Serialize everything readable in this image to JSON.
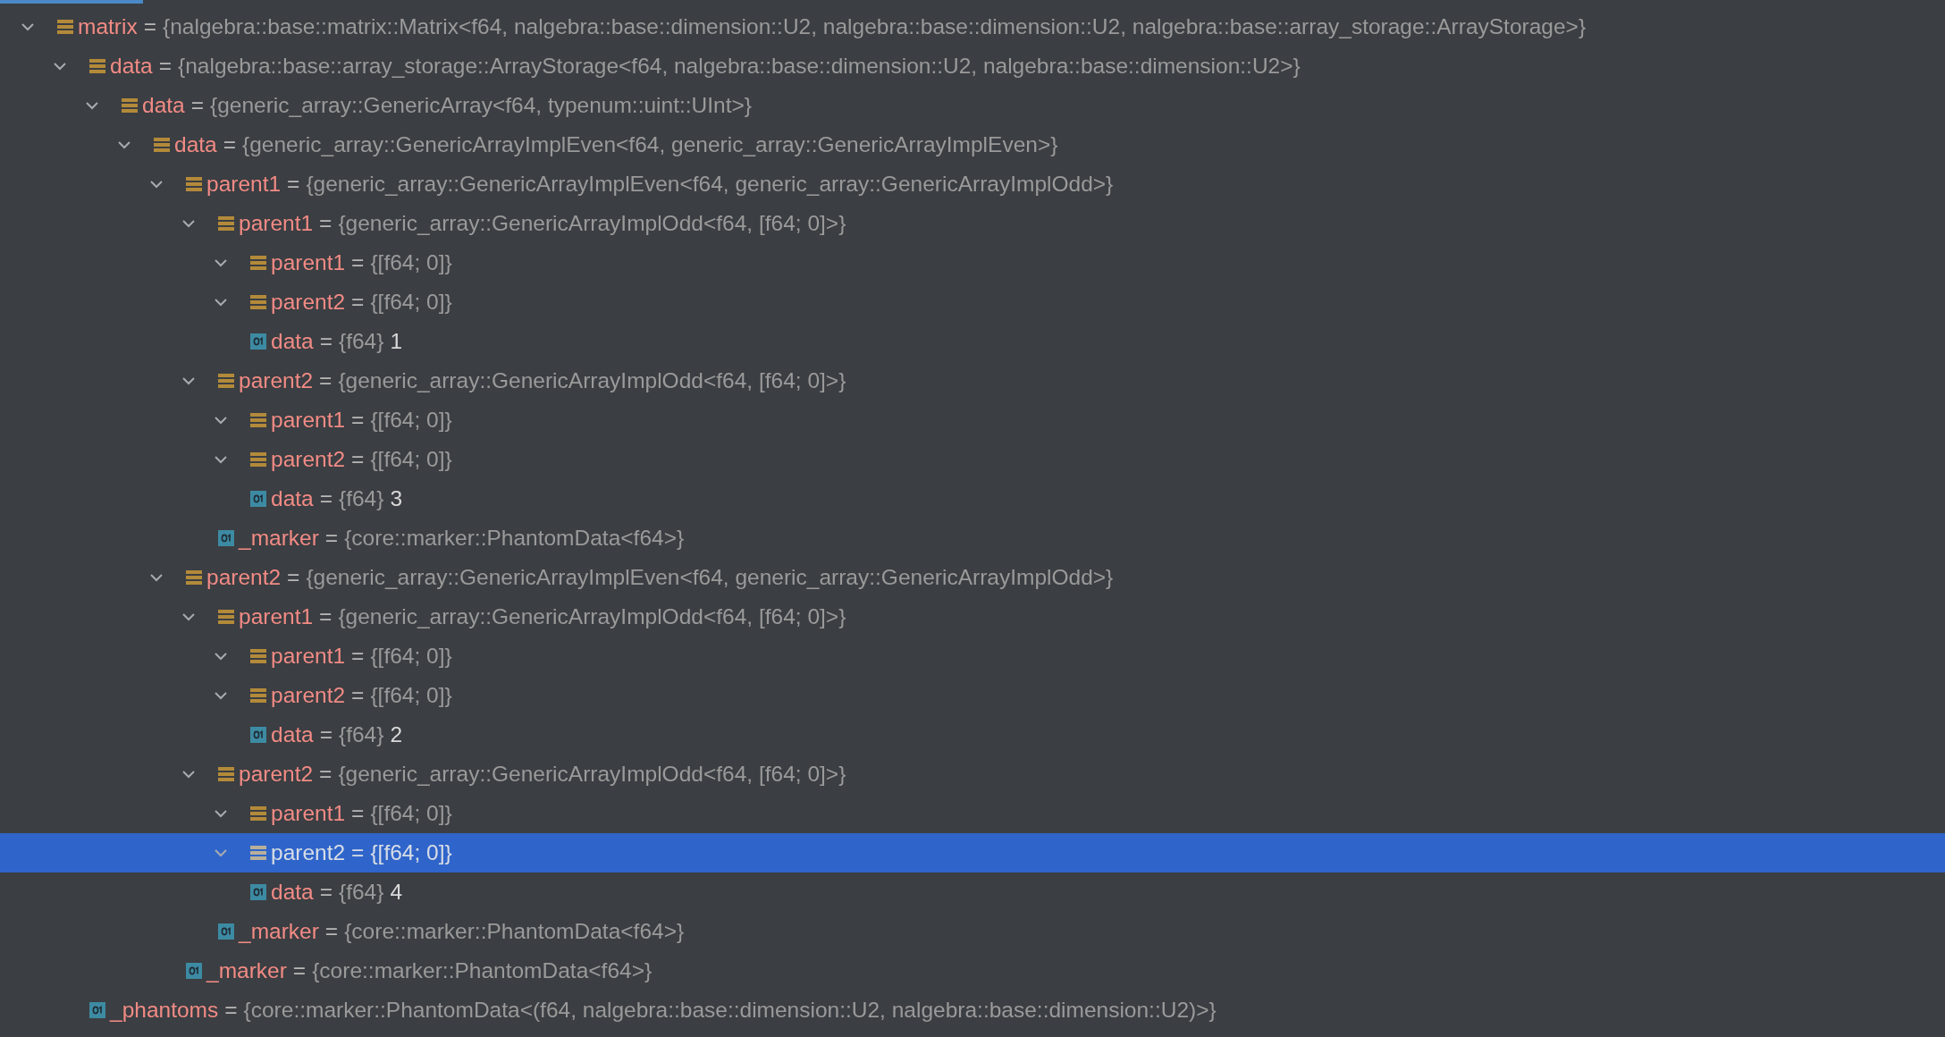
{
  "variables": [
    {
      "name": "matrix",
      "op": "=",
      "type": "{nalgebra::base::matrix::Matrix<f64, nalgebra::base::dimension::U2, nalgebra::base::dimension::U2, nalgebra::base::array_storage::ArrayStorage>}",
      "kind": "struct",
      "expanded": true,
      "selected": false,
      "children": [
        {
          "name": "data",
          "op": "=",
          "type": "{nalgebra::base::array_storage::ArrayStorage<f64, nalgebra::base::dimension::U2, nalgebra::base::dimension::U2>}",
          "kind": "struct",
          "expanded": true,
          "selected": false,
          "children": [
            {
              "name": "data",
              "op": "=",
              "type": "{generic_array::GenericArray<f64, typenum::uint::UInt>}",
              "kind": "struct",
              "expanded": true,
              "selected": false,
              "children": [
                {
                  "name": "data",
                  "op": "=",
                  "type": "{generic_array::GenericArrayImplEven<f64, generic_array::GenericArrayImplEven>}",
                  "kind": "struct",
                  "expanded": true,
                  "selected": false,
                  "children": [
                    {
                      "name": "parent1",
                      "op": "=",
                      "type": "{generic_array::GenericArrayImplEven<f64, generic_array::GenericArrayImplOdd>}",
                      "kind": "struct",
                      "expanded": true,
                      "selected": false,
                      "children": [
                        {
                          "name": "parent1",
                          "op": "=",
                          "type": "{generic_array::GenericArrayImplOdd<f64, [f64; 0]>}",
                          "kind": "struct",
                          "expanded": true,
                          "selected": false,
                          "children": [
                            {
                              "name": "parent1",
                              "op": "=",
                              "type": "{[f64; 0]}",
                              "kind": "struct",
                              "expanded": true,
                              "selected": false
                            },
                            {
                              "name": "parent2",
                              "op": "=",
                              "type": "{[f64; 0]}",
                              "kind": "struct",
                              "expanded": true,
                              "selected": false
                            },
                            {
                              "name": "data",
                              "op": "=",
                              "type": "{f64}",
                              "value": "1",
                              "kind": "primitive",
                              "selected": false
                            }
                          ]
                        },
                        {
                          "name": "parent2",
                          "op": "=",
                          "type": "{generic_array::GenericArrayImplOdd<f64, [f64; 0]>}",
                          "kind": "struct",
                          "expanded": true,
                          "selected": false,
                          "children": [
                            {
                              "name": "parent1",
                              "op": "=",
                              "type": "{[f64; 0]}",
                              "kind": "struct",
                              "expanded": true,
                              "selected": false
                            },
                            {
                              "name": "parent2",
                              "op": "=",
                              "type": "{[f64; 0]}",
                              "kind": "struct",
                              "expanded": true,
                              "selected": false
                            },
                            {
                              "name": "data",
                              "op": "=",
                              "type": "{f64}",
                              "value": "3",
                              "kind": "primitive",
                              "selected": false
                            }
                          ]
                        },
                        {
                          "name": "_marker",
                          "op": "=",
                          "type": "{core::marker::PhantomData<f64>}",
                          "kind": "primitive",
                          "selected": false
                        }
                      ]
                    },
                    {
                      "name": "parent2",
                      "op": "=",
                      "type": "{generic_array::GenericArrayImplEven<f64, generic_array::GenericArrayImplOdd>}",
                      "kind": "struct",
                      "expanded": true,
                      "selected": false,
                      "children": [
                        {
                          "name": "parent1",
                          "op": "=",
                          "type": "{generic_array::GenericArrayImplOdd<f64, [f64; 0]>}",
                          "kind": "struct",
                          "expanded": true,
                          "selected": false,
                          "children": [
                            {
                              "name": "parent1",
                              "op": "=",
                              "type": "{[f64; 0]}",
                              "kind": "struct",
                              "expanded": true,
                              "selected": false
                            },
                            {
                              "name": "parent2",
                              "op": "=",
                              "type": "{[f64; 0]}",
                              "kind": "struct",
                              "expanded": true,
                              "selected": false
                            },
                            {
                              "name": "data",
                              "op": "=",
                              "type": "{f64}",
                              "value": "2",
                              "kind": "primitive",
                              "selected": false
                            }
                          ]
                        },
                        {
                          "name": "parent2",
                          "op": "=",
                          "type": "{generic_array::GenericArrayImplOdd<f64, [f64; 0]>}",
                          "kind": "struct",
                          "expanded": true,
                          "selected": false,
                          "children": [
                            {
                              "name": "parent1",
                              "op": "=",
                              "type": "{[f64; 0]}",
                              "kind": "struct",
                              "expanded": true,
                              "selected": false
                            },
                            {
                              "name": "parent2",
                              "op": "=",
                              "type": "{[f64; 0]}",
                              "kind": "struct",
                              "expanded": true,
                              "selected": true
                            },
                            {
                              "name": "data",
                              "op": "=",
                              "type": "{f64}",
                              "value": "4",
                              "kind": "primitive",
                              "selected": false
                            }
                          ]
                        },
                        {
                          "name": "_marker",
                          "op": "=",
                          "type": "{core::marker::PhantomData<f64>}",
                          "kind": "primitive",
                          "selected": false
                        }
                      ]
                    },
                    {
                      "name": "_marker",
                      "op": "=",
                      "type": "{core::marker::PhantomData<f64>}",
                      "kind": "primitive",
                      "selected": false
                    }
                  ]
                }
              ]
            }
          ]
        },
        {
          "name": "_phantoms",
          "op": "=",
          "type": "{core::marker::PhantomData<(f64, nalgebra::base::dimension::U2, nalgebra::base::dimension::U2)>}",
          "kind": "primitive",
          "selected": false
        }
      ]
    }
  ]
}
